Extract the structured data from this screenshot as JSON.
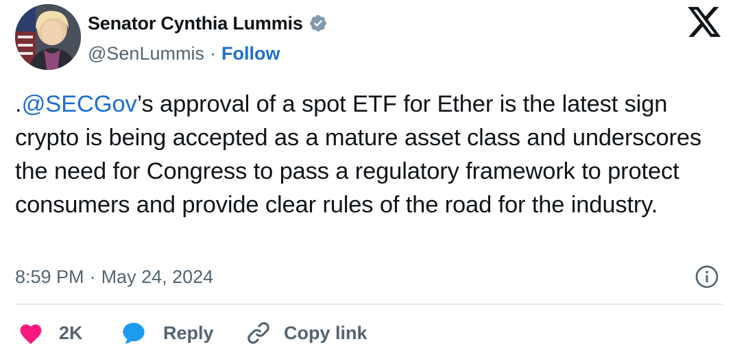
{
  "author": {
    "display_name": "Senator Cynthia Lummis",
    "handle": "@SenLummis",
    "separator": "·",
    "follow_label": "Follow"
  },
  "tweet": {
    "prefix": ".",
    "mention": "@SECGov",
    "body": "’s approval of a spot ETF for Ether is the latest sign crypto is being accepted as a mature asset class and underscores the need for Congress to pass a regulatory framework to protect consumers and provide clear rules of the road for the industry."
  },
  "meta": {
    "time": "8:59 PM",
    "separator": "·",
    "date": "May 24, 2024"
  },
  "actions": {
    "like_count": "2K",
    "reply_label": "Reply",
    "copy_link_label": "Copy link"
  },
  "icons": {
    "verified": "verified-badge-icon",
    "logo": "x-logo-icon",
    "info": "info-icon",
    "like": "heart-icon",
    "reply": "speech-bubble-icon",
    "copy_link": "link-icon"
  },
  "colors": {
    "link_blue": "#1d6fd0",
    "like_pink": "#f91880",
    "reply_blue": "#1d9bf0",
    "secondary_text": "#536471",
    "verified_gray": "#829aab"
  }
}
